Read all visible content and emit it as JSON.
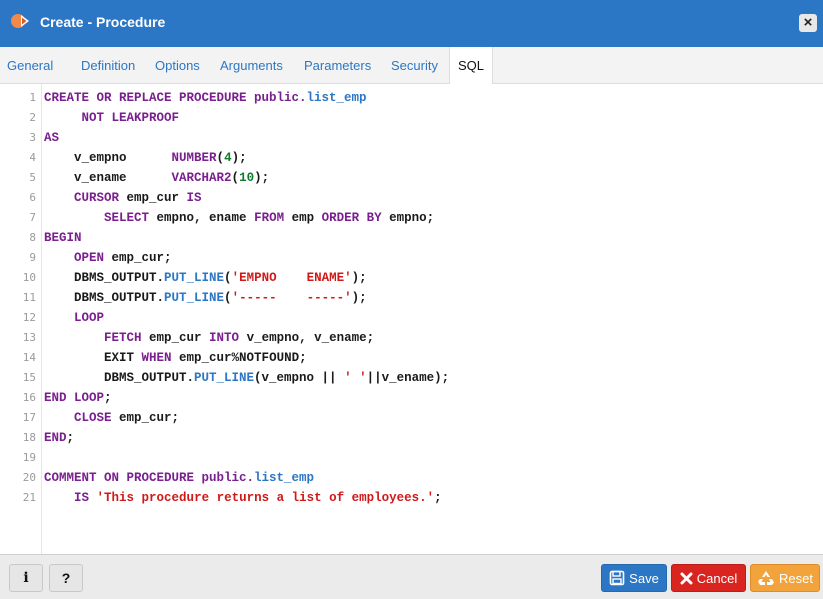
{
  "window": {
    "title": "Create - Procedure",
    "title_icon": "procedure-icon",
    "close_label": "×"
  },
  "tabs": [
    {
      "label": "General"
    },
    {
      "label": "Definition"
    },
    {
      "label": "Options"
    },
    {
      "label": "Arguments"
    },
    {
      "label": "Parameters"
    },
    {
      "label": "Security"
    },
    {
      "label": "SQL",
      "active": true
    }
  ],
  "editor": {
    "line_numbers": [
      "1",
      "2",
      "3",
      "4",
      "5",
      "6",
      "7",
      "8",
      "9",
      "10",
      "11",
      "12",
      "13",
      "14",
      "15",
      "16",
      "17",
      "18",
      "19",
      "20",
      "21"
    ],
    "lines": [
      [
        {
          "t": "CREATE OR REPLACE PROCEDURE public.",
          "c": "kw"
        },
        {
          "t": "list_emp",
          "c": "fn"
        }
      ],
      [
        {
          "t": "     NOT LEAKPROOF",
          "c": "kw"
        }
      ],
      [
        {
          "t": "AS",
          "c": "kw"
        }
      ],
      [
        {
          "t": "    v_empno      "
        },
        {
          "t": "NUMBER",
          "c": "kw"
        },
        {
          "t": "("
        },
        {
          "t": "4",
          "c": "num"
        },
        {
          "t": ");"
        }
      ],
      [
        {
          "t": "    v_ename      "
        },
        {
          "t": "VARCHAR2",
          "c": "kw"
        },
        {
          "t": "("
        },
        {
          "t": "10",
          "c": "num"
        },
        {
          "t": ");"
        }
      ],
      [
        {
          "t": "    "
        },
        {
          "t": "CURSOR",
          "c": "kw"
        },
        {
          "t": " emp_cur "
        },
        {
          "t": "IS",
          "c": "kw"
        }
      ],
      [
        {
          "t": "        "
        },
        {
          "t": "SELECT",
          "c": "kw"
        },
        {
          "t": " empno, ename "
        },
        {
          "t": "FROM",
          "c": "kw"
        },
        {
          "t": " emp "
        },
        {
          "t": "ORDER BY",
          "c": "kw"
        },
        {
          "t": " empno;"
        }
      ],
      [
        {
          "t": "BEGIN",
          "c": "kw"
        }
      ],
      [
        {
          "t": "    "
        },
        {
          "t": "OPEN",
          "c": "kw"
        },
        {
          "t": " emp_cur;"
        }
      ],
      [
        {
          "t": "    DBMS_OUTPUT."
        },
        {
          "t": "PUT_LINE",
          "c": "fn"
        },
        {
          "t": "("
        },
        {
          "t": "'EMPNO    ENAME'",
          "c": "str"
        },
        {
          "t": ");"
        }
      ],
      [
        {
          "t": "    DBMS_OUTPUT."
        },
        {
          "t": "PUT_LINE",
          "c": "fn"
        },
        {
          "t": "("
        },
        {
          "t": "'-----    -----'",
          "c": "str"
        },
        {
          "t": ");"
        }
      ],
      [
        {
          "t": "    "
        },
        {
          "t": "LOOP",
          "c": "kw"
        }
      ],
      [
        {
          "t": "        "
        },
        {
          "t": "FETCH",
          "c": "kw"
        },
        {
          "t": " emp_cur "
        },
        {
          "t": "INTO",
          "c": "kw"
        },
        {
          "t": " v_empno, v_ename;"
        }
      ],
      [
        {
          "t": "        EXIT "
        },
        {
          "t": "WHEN",
          "c": "kw"
        },
        {
          "t": " emp_cur%NOTFOUND;"
        }
      ],
      [
        {
          "t": "        DBMS_OUTPUT."
        },
        {
          "t": "PUT_LINE",
          "c": "fn"
        },
        {
          "t": "(v_empno || "
        },
        {
          "t": "' '",
          "c": "str"
        },
        {
          "t": "||v_ename);"
        }
      ],
      [
        {
          "t": "END LOOP",
          "c": "kw"
        },
        {
          "t": ";"
        }
      ],
      [
        {
          "t": "    "
        },
        {
          "t": "CLOSE",
          "c": "kw"
        },
        {
          "t": " emp_cur;"
        }
      ],
      [
        {
          "t": "END",
          "c": "kw"
        },
        {
          "t": ";"
        }
      ],
      [],
      [
        {
          "t": "COMMENT ON PROCEDURE public.",
          "c": "kw"
        },
        {
          "t": "list_emp",
          "c": "fn"
        }
      ],
      [
        {
          "t": "    "
        },
        {
          "t": "IS",
          "c": "kw"
        },
        {
          "t": " "
        },
        {
          "t": "'This procedure returns a list of employees.'",
          "c": "str"
        },
        {
          "t": ";"
        }
      ]
    ]
  },
  "footer": {
    "info_label": "i",
    "help_label": "?",
    "save_label": "Save",
    "cancel_label": "Cancel",
    "reset_label": "Reset"
  },
  "colors": {
    "accent": "#2c77c5",
    "keyword": "#7a1f8f",
    "string": "#d01919",
    "number": "#11792b",
    "cancel": "#d9241f",
    "reset": "#f2a33c"
  }
}
